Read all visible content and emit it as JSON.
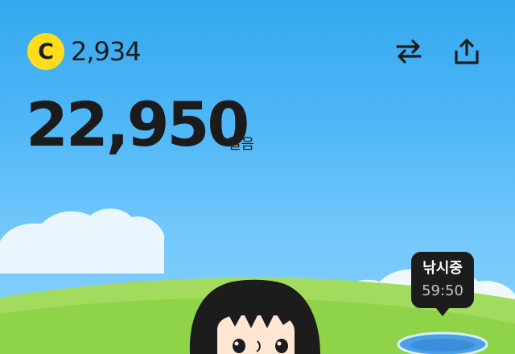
{
  "header": {
    "coin": {
      "letter": "C",
      "amount": "2,934",
      "color": "#ffdd1c"
    },
    "actions": [
      {
        "name": "swap-arrows-icon"
      },
      {
        "name": "share-icon"
      }
    ]
  },
  "steps": {
    "value": "22,950",
    "unit": "걸음"
  },
  "fishing": {
    "status": "낚시중",
    "timer": "59:50"
  },
  "colors": {
    "sky": "#4fb7f6",
    "grass": "#8fd348",
    "text": "#1b1b1b"
  }
}
